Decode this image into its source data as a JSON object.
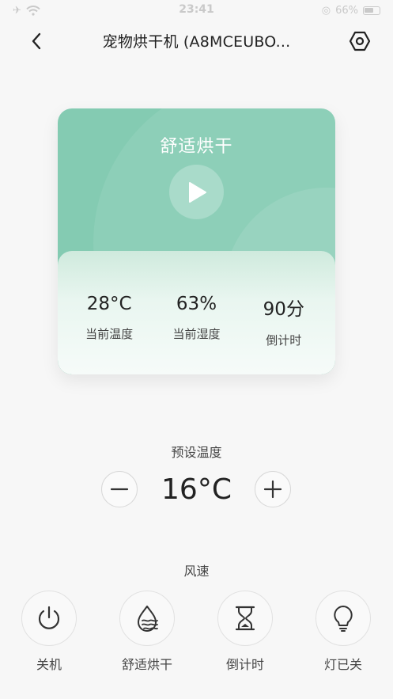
{
  "status_bar": {
    "time": "23:41",
    "battery": "66%"
  },
  "nav": {
    "title": "宠物烘干机 (A8MCEUBO..."
  },
  "card": {
    "mode_title": "舒适烘干",
    "stats": [
      {
        "value": "28°C",
        "label": "当前温度"
      },
      {
        "value": "63%",
        "label": "当前湿度"
      },
      {
        "value": "90分",
        "label": "倒计时"
      }
    ],
    "accent_color": "#84cbb2"
  },
  "preset": {
    "label": "预设温度",
    "value": "16°C"
  },
  "wind": {
    "label": "风速"
  },
  "controls": [
    {
      "label": "关机",
      "icon": "power-icon"
    },
    {
      "label": "舒适烘干",
      "icon": "water-drop-wave-icon"
    },
    {
      "label": "倒计时",
      "icon": "hourglass-icon"
    },
    {
      "label": "灯已关",
      "icon": "bulb-icon"
    }
  ]
}
